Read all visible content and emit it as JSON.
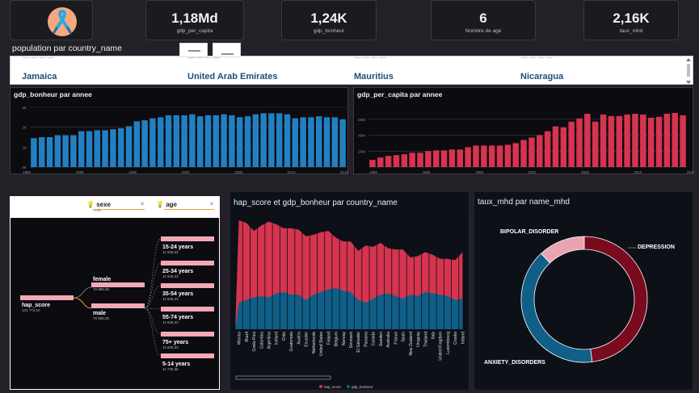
{
  "colors": {
    "blue": "#2280c2",
    "red": "#d6344f",
    "dark_red": "#7a0a1e",
    "teal_blue": "#0f5f88",
    "pink": "#eaa3b0",
    "salmon": "#f3a9b4"
  },
  "logo": {
    "icon": "awareness-ribbon-icon"
  },
  "kpis": [
    {
      "value": "1,18Md",
      "label": "gdp_per_capita"
    },
    {
      "value": "1,24K",
      "label": "gdp_bonheur"
    },
    {
      "value": "6",
      "label": "Nombre de age"
    },
    {
      "value": "2,16K",
      "label": "taux_mhd"
    }
  ],
  "population": {
    "title": "population par country_name",
    "countries": [
      "Jamaica",
      "United Arab Emirates",
      "Mauritius",
      "Nicaragua"
    ]
  },
  "decomposition": {
    "filter_sexe": "sexe",
    "filter_sexe_value": "male",
    "filter_age": "age",
    "root": {
      "label": "hap_score",
      "value": "141 772,10"
    },
    "sexe_nodes": [
      {
        "label": "female",
        "value": "70 886,05"
      },
      {
        "label": "male",
        "value": "70 886,05"
      }
    ],
    "age_nodes": [
      {
        "label": "15-24 years",
        "value": "11 628,33"
      },
      {
        "label": "25-34 years",
        "value": "11 628,33"
      },
      {
        "label": "35-54 years",
        "value": "11 628,33"
      },
      {
        "label": "55-74 years",
        "value": "11 628,33"
      },
      {
        "label": "75+ years",
        "value": "11 628,33"
      },
      {
        "label": "5-14 years",
        "value": "11 745,38"
      }
    ]
  },
  "mhd_chart": {
    "title": "taux_mhd par name_mhd"
  },
  "hap_chart": {
    "title": "hap_score et gdp_bonheur par country_name"
  },
  "chart_data": [
    {
      "type": "bar",
      "title": "gdp_bonheur par annee",
      "x": [
        1990,
        1991,
        1992,
        1993,
        1994,
        1995,
        1996,
        1997,
        1998,
        1999,
        2000,
        2001,
        2002,
        2003,
        2004,
        2005,
        2006,
        2007,
        2008,
        2009,
        2010,
        2011,
        2012,
        2013,
        2014,
        2015,
        2016,
        2017,
        2018,
        2019,
        2020,
        2021,
        2022,
        2023,
        2024,
        2025,
        2026,
        2027,
        2028,
        2029,
        2030,
        2031,
        2032
      ],
      "values": [
        1.45,
        1.5,
        1.5,
        1.6,
        1.6,
        1.6,
        1.8,
        1.8,
        1.85,
        1.85,
        1.9,
        1.95,
        2.05,
        2.3,
        2.35,
        2.45,
        2.5,
        2.6,
        2.6,
        2.6,
        2.65,
        2.55,
        2.6,
        2.6,
        2.65,
        2.6,
        2.5,
        2.55,
        2.65,
        2.7,
        2.7,
        2.7,
        2.65,
        2.45,
        2.5,
        2.5,
        2.55,
        2.5,
        2.5,
        2.4
      ],
      "y_ticks": [
        "0K",
        "1K",
        "2K",
        "3K"
      ],
      "x_ticks": [
        "1985",
        "1990",
        "1995",
        "2000",
        "2005",
        "2010",
        "2015"
      ],
      "ylim": [
        0,
        3
      ],
      "grid": true,
      "color": "#2280c2"
    },
    {
      "type": "bar",
      "title": "gdp_per_capita par annee",
      "values": [
        9,
        12,
        14,
        15,
        16,
        18,
        18,
        20,
        21,
        21,
        22,
        22,
        25,
        27,
        27,
        27,
        27,
        28,
        30,
        34,
        37,
        40,
        45,
        51,
        50,
        57,
        61,
        67,
        57,
        66,
        64,
        64,
        66,
        67,
        66,
        62,
        63,
        67,
        68,
        65
      ],
      "y_ticks": [
        "20M",
        "40M",
        "60M"
      ],
      "x_ticks": [
        "1985",
        "1990",
        "1995",
        "2000",
        "2005",
        "2010",
        "2015"
      ],
      "ylim": [
        0,
        75
      ],
      "grid": true,
      "color": "#d6344f"
    },
    {
      "type": "area",
      "title": "hap_score et gdp_bonheur par country_name",
      "categories": [
        "Mexico",
        "Brazil",
        "Costa Rica",
        "Colombia",
        "Argentina",
        "Iceland",
        "Chile",
        "Guatemala",
        "Austria",
        "Ecuador",
        "Netherlands",
        "United States",
        "Finland",
        "Belgium",
        "Norway",
        "Denmark",
        "El Salvador",
        "Panama",
        "Canada",
        "Sweden",
        "Australia",
        "France",
        "Spain",
        "New Zealand",
        "Uruguay",
        "Thailand",
        "Italy",
        "United Kingdom",
        "Luxembourg",
        "Croatia",
        "Ireland"
      ],
      "series": [
        {
          "name": "hap_score",
          "values": [
            82,
            80,
            74,
            78,
            81,
            79,
            76,
            76,
            75,
            70,
            71,
            73,
            74,
            69,
            66,
            66,
            59,
            63,
            62,
            65,
            61,
            60,
            60,
            54,
            55,
            58,
            56,
            53,
            53,
            52,
            58
          ]
        },
        {
          "name": "gdp_bonheur",
          "values": [
            20,
            22,
            24,
            25,
            24,
            27,
            28,
            26,
            26,
            22,
            26,
            28,
            30,
            31,
            29,
            28,
            22,
            20,
            23,
            26,
            27,
            25,
            23,
            26,
            25,
            28,
            27,
            26,
            25,
            22,
            23
          ]
        }
      ],
      "color_hap": "#d6344f",
      "color_gdp": "#0f5f88"
    },
    {
      "type": "pie",
      "title": "taux_mhd par name_mhd",
      "labels": [
        "DEPRESSION",
        "ANXIETY_DISORDERS",
        "BIPOLAR_DISORDER"
      ],
      "values": [
        48,
        40,
        12
      ],
      "colors": [
        "#7a0a1e",
        "#0f5f88",
        "#eaa3b0"
      ]
    }
  ]
}
